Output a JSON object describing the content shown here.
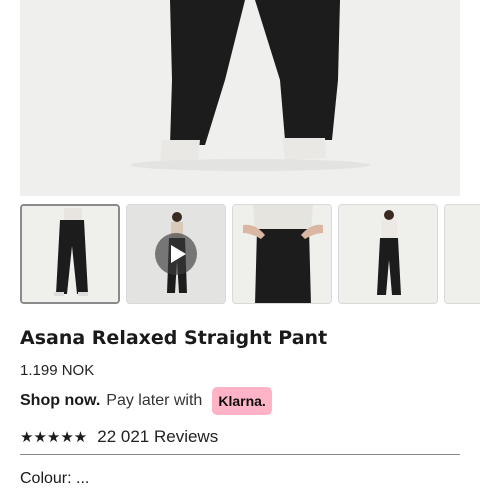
{
  "product": {
    "title": "Asana Relaxed Straight Pant",
    "price": "1.199 NOK"
  },
  "payment": {
    "shop_now": "Shop now.",
    "pay_later": "Pay later with",
    "klarna": "Klarna."
  },
  "reviews": {
    "stars": "★★★★★",
    "rating": 5,
    "count_text": "22 021 Reviews"
  },
  "next_section": {
    "label": "Colour: ..."
  },
  "colors": {
    "pants": "#1c1c1c",
    "klarna_pink": "#ffb3c7",
    "background": "#ffffff"
  },
  "gallery": {
    "thumbnails": [
      {
        "kind": "front-view",
        "selected": true
      },
      {
        "kind": "video",
        "selected": false
      },
      {
        "kind": "detail-view",
        "selected": false
      },
      {
        "kind": "front-view",
        "selected": false
      },
      {
        "kind": "partial",
        "selected": false
      }
    ]
  }
}
